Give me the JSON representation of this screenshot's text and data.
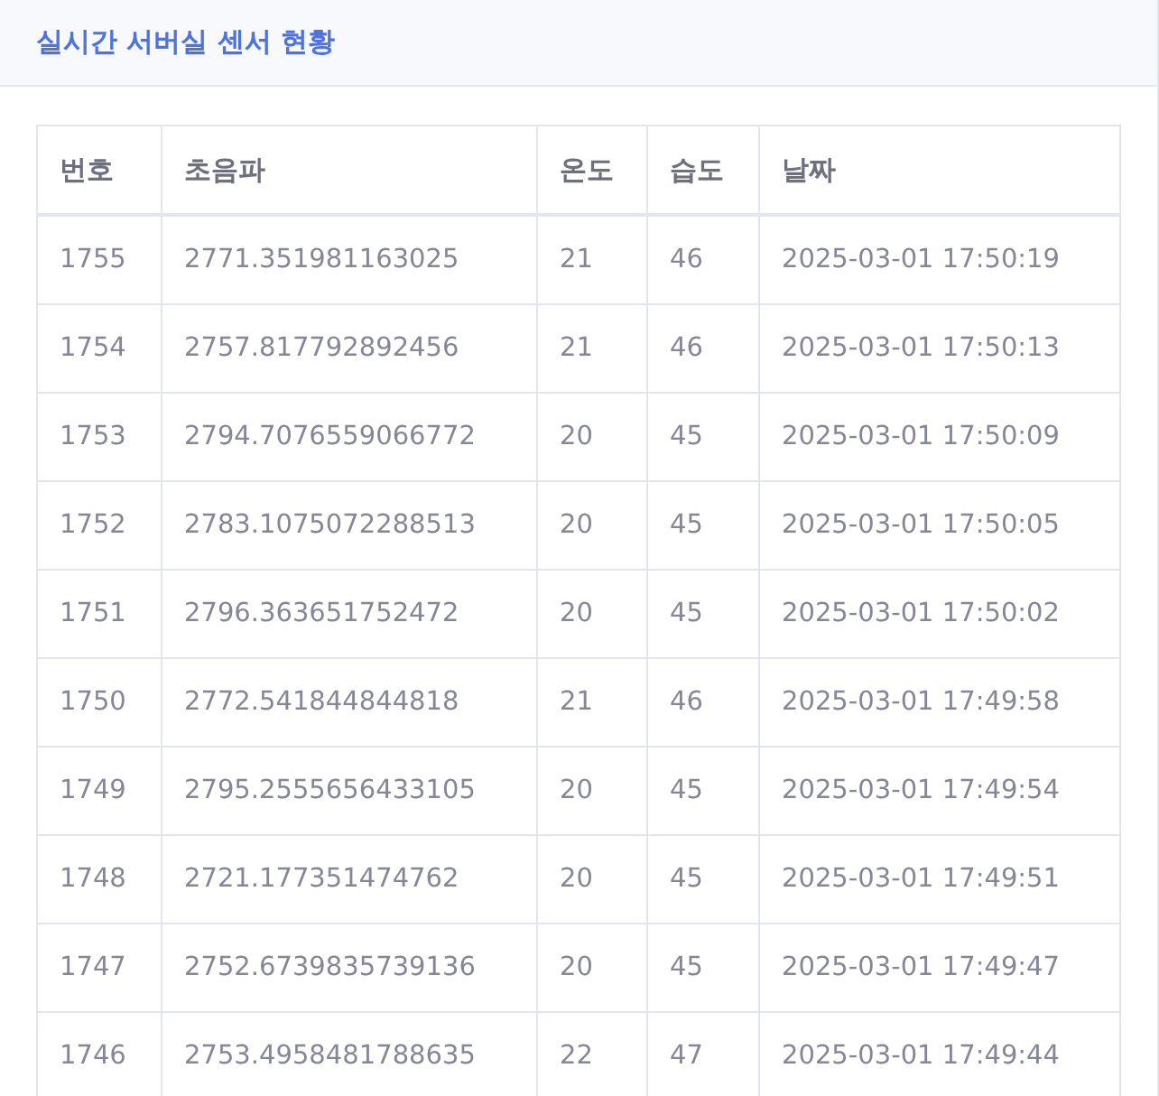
{
  "card": {
    "title": "실시간 서버실 센서 현황"
  },
  "table": {
    "columns": [
      "번호",
      "초음파",
      "온도",
      "습도",
      "날짜"
    ],
    "rows": [
      [
        "1755",
        "2771.351981163025",
        "21",
        "46",
        "2025-03-01 17:50:19"
      ],
      [
        "1754",
        "2757.817792892456",
        "21",
        "46",
        "2025-03-01 17:50:13"
      ],
      [
        "1753",
        "2794.7076559066772",
        "20",
        "45",
        "2025-03-01 17:50:09"
      ],
      [
        "1752",
        "2783.1075072288513",
        "20",
        "45",
        "2025-03-01 17:50:05"
      ],
      [
        "1751",
        "2796.363651752472",
        "20",
        "45",
        "2025-03-01 17:50:02"
      ],
      [
        "1750",
        "2772.541844844818",
        "21",
        "46",
        "2025-03-01 17:49:58"
      ],
      [
        "1749",
        "2795.2555656433105",
        "20",
        "45",
        "2025-03-01 17:49:54"
      ],
      [
        "1748",
        "2721.177351474762",
        "20",
        "45",
        "2025-03-01 17:49:51"
      ],
      [
        "1747",
        "2752.6739835739136",
        "20",
        "45",
        "2025-03-01 17:49:47"
      ],
      [
        "1746",
        "2753.4958481788635",
        "22",
        "47",
        "2025-03-01 17:49:44"
      ]
    ]
  }
}
